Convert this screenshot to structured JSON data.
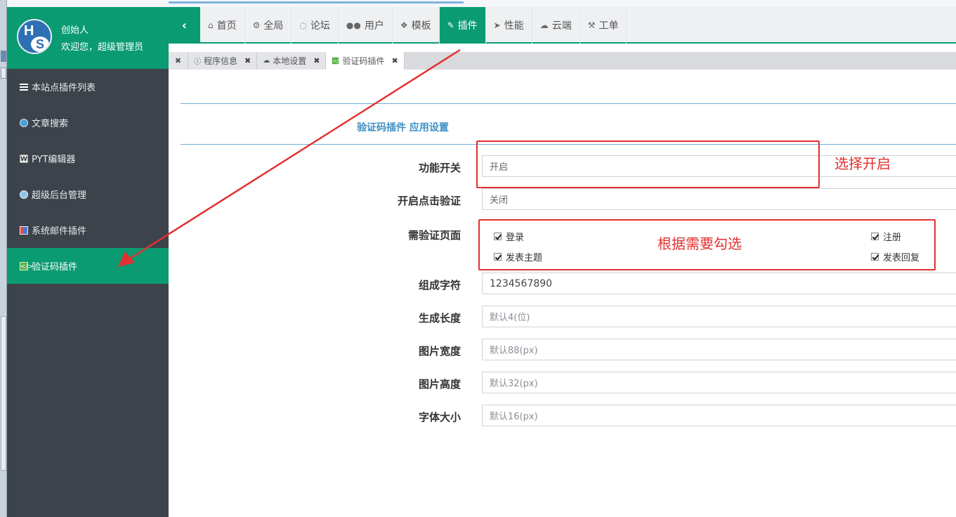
{
  "user": {
    "avatar_initials": "HS",
    "name": "创始人",
    "welcome": "欢迎您，超级管理员"
  },
  "sidebar": {
    "items": [
      {
        "label": "本站点插件列表",
        "icon": "list-icon"
      },
      {
        "label": "文章搜索",
        "icon": "search-icon"
      },
      {
        "label": "PYT编辑器",
        "icon": "editor-icon"
      },
      {
        "label": "超级后台管理",
        "icon": "globe-icon"
      },
      {
        "label": "系统邮件插件",
        "icon": "mail-icon"
      },
      {
        "label": "验证码插件",
        "icon": "captcha-icon",
        "active": true
      }
    ]
  },
  "topnav": {
    "items": [
      {
        "label": "首页",
        "icon": "home-icon"
      },
      {
        "label": "全局",
        "icon": "gears-icon"
      },
      {
        "label": "论坛",
        "icon": "comment-icon"
      },
      {
        "label": "用户",
        "icon": "users-icon"
      },
      {
        "label": "模板",
        "icon": "puzzle-icon"
      },
      {
        "label": "插件",
        "icon": "plug-icon",
        "active": true
      },
      {
        "label": "性能",
        "icon": "send-icon"
      },
      {
        "label": "云端",
        "icon": "cloud-icon"
      },
      {
        "label": "工单",
        "icon": "wrench-icon"
      }
    ]
  },
  "tabs": [
    {
      "label": "程序信息",
      "icon": "info-icon"
    },
    {
      "label": "本地设置",
      "icon": "cloud-icon"
    },
    {
      "label": "验证码插件",
      "icon": "captcha-icon",
      "active": true
    }
  ],
  "panel": {
    "title": "验证码插件 应用设置"
  },
  "form": {
    "switch": {
      "label": "功能开关",
      "value": "开启"
    },
    "click_verify": {
      "label": "开启点击验证",
      "value": "关闭"
    },
    "pages": {
      "label": "需验证页面",
      "options": [
        {
          "label": "登录",
          "checked": true
        },
        {
          "label": "注册",
          "checked": true
        },
        {
          "label": "发表主题",
          "checked": true
        },
        {
          "label": "发表回复",
          "checked": true
        }
      ]
    },
    "chars": {
      "label": "组成字符",
      "value": "1234567890"
    },
    "length": {
      "label": "生成长度",
      "placeholder": "默认4(位)"
    },
    "width": {
      "label": "图片宽度",
      "placeholder": "默认88(px)"
    },
    "height": {
      "label": "图片高度",
      "placeholder": "默认32(px)"
    },
    "fontsize": {
      "label": "字体大小",
      "placeholder": "默认16(px)"
    }
  },
  "annotations": {
    "choose_on": "选择开启",
    "check_as_needed": "根据需要勾选",
    "color": "#e33030"
  },
  "colors": {
    "accent": "#0a9b72",
    "sidebar_bg": "#3d434a",
    "title_blue": "#3f8fc4"
  }
}
